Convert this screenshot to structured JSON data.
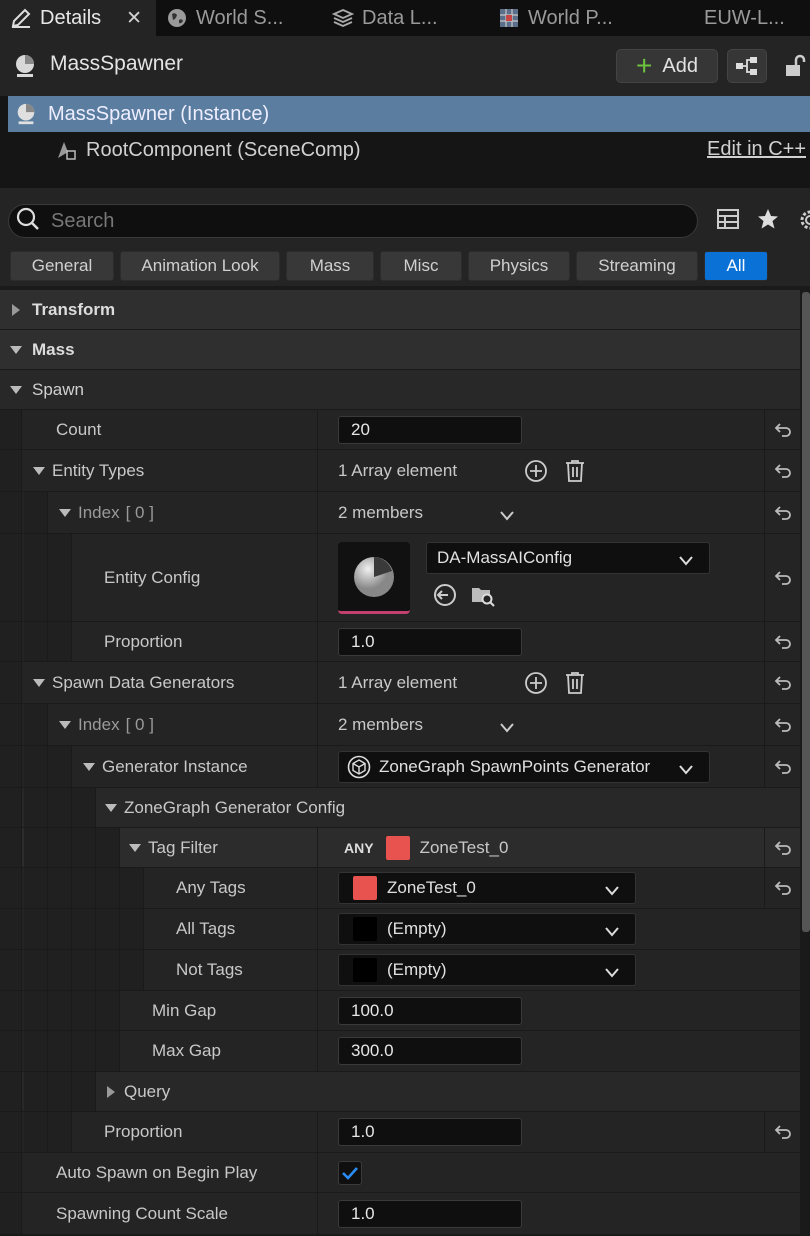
{
  "tabs": [
    {
      "label": "Details",
      "icon": "pencil-icon",
      "active": true
    },
    {
      "label": "World S...",
      "icon": "globe-icon"
    },
    {
      "label": "Data L...",
      "icon": "layers-icon"
    },
    {
      "label": "World P...",
      "icon": "grid-map-icon"
    },
    {
      "label": "EUW-L...",
      "icon": ""
    }
  ],
  "header": {
    "actor_name": "MassSpawner",
    "add_label": "Add",
    "components": {
      "instance": "MassSpawner (Instance)",
      "root": "RootComponent (SceneComp)",
      "edit_link": "Edit in C++"
    }
  },
  "search": {
    "placeholder": "Search"
  },
  "filters": [
    "General",
    "Animation Look",
    "Mass",
    "Misc",
    "Physics",
    "Streaming",
    "All"
  ],
  "active_filter": "All",
  "categories": {
    "transform": "Transform",
    "mass": "Mass",
    "spawn": "Spawn"
  },
  "props": {
    "count": {
      "label": "Count",
      "value": "20"
    },
    "entity_types": {
      "label": "Entity Types",
      "value": "1 Array element"
    },
    "et_index": {
      "label": "Index",
      "index": "[ 0 ]",
      "value": "2 members"
    },
    "entity_config": {
      "label": "Entity Config",
      "value": "DA-MassAIConfig"
    },
    "proportion1": {
      "label": "Proportion",
      "value": "1.0"
    },
    "spawn_gens": {
      "label": "Spawn Data Generators",
      "value": "1 Array element"
    },
    "sg_index": {
      "label": "Index",
      "index": "[ 0 ]",
      "value": "2 members"
    },
    "gen_instance": {
      "label": "Generator Instance",
      "value": "ZoneGraph SpawnPoints Generator"
    },
    "zg_config": {
      "label": "ZoneGraph Generator Config"
    },
    "tag_filter": {
      "label": "Tag Filter",
      "mode": "ANY",
      "value": "ZoneTest_0"
    },
    "any_tags": {
      "label": "Any Tags",
      "value": "ZoneTest_0"
    },
    "all_tags": {
      "label": "All Tags",
      "value": "(Empty)"
    },
    "not_tags": {
      "label": "Not Tags",
      "value": "(Empty)"
    },
    "min_gap": {
      "label": "Min Gap",
      "value": "100.0"
    },
    "max_gap": {
      "label": "Max Gap",
      "value": "300.0"
    },
    "query": {
      "label": "Query"
    },
    "proportion2": {
      "label": "Proportion",
      "value": "1.0"
    },
    "auto_spawn": {
      "label": "Auto Spawn on Begin Play",
      "checked": true
    },
    "count_scale": {
      "label": "Spawning Count Scale",
      "value": "1.0"
    }
  },
  "colors": {
    "accent": "#0a71d6",
    "tag": "#e8524f",
    "selection": "#5a7da0",
    "add_plus": "#6cc43e"
  }
}
